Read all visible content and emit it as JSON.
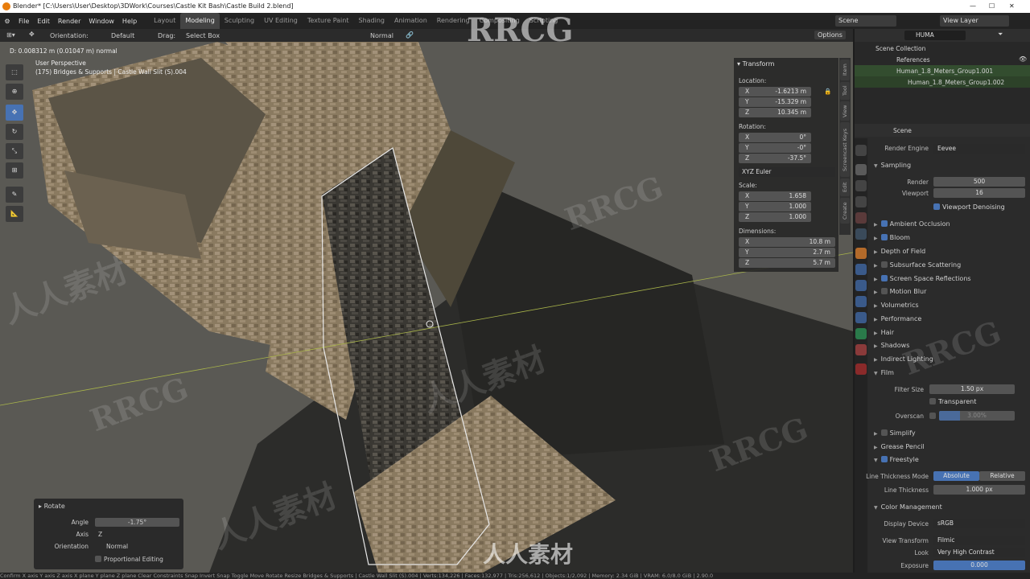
{
  "window_title": "Blender* [C:\\Users\\User\\Desktop\\3DWork\\Courses\\Castle Kit Bash\\Castle Build 2.blend]",
  "menu": [
    "File",
    "Edit",
    "Render",
    "Window",
    "Help"
  ],
  "workspaces": [
    "Layout",
    "Modeling",
    "Sculpting",
    "UV Editing",
    "Texture Paint",
    "Shading",
    "Animation",
    "Rendering",
    "Compositing",
    "Scripting"
  ],
  "active_workspace": "Modeling",
  "scene_name": "Scene",
  "view_layer": "View Layer",
  "toolbar": {
    "orientation_label": "Orientation:",
    "orientation_value": "Default",
    "drag_label": "Drag:",
    "drag_value": "Select Box",
    "pivot": "Normal",
    "options": "Options"
  },
  "viewport": {
    "info_line1": "D: 0.008312 m (0.01047 m) normal",
    "info_line2": "User Perspective",
    "info_line3": "(175) Bridges & Supports | Castle Wall Slit (S).004"
  },
  "transform": {
    "title": "Transform",
    "location_label": "Location:",
    "location": {
      "x": "-1.6213 m",
      "y": "-15.329 m",
      "z": "10.345 m"
    },
    "rotation_label": "Rotation:",
    "rotation": {
      "x": "0°",
      "y": "-0°",
      "z": "-37.5°"
    },
    "rotation_mode": "XYZ Euler",
    "scale_label": "Scale:",
    "scale": {
      "x": "1.658",
      "y": "1.000",
      "z": "1.000"
    },
    "dimensions_label": "Dimensions:",
    "dimensions": {
      "x": "10.8 m",
      "y": "2.7 m",
      "z": "5.7 m"
    }
  },
  "side_tabs": [
    "Item",
    "Tool",
    "View",
    "Screencast Keys",
    "Edit",
    "Create"
  ],
  "rotate_panel": {
    "title": "Rotate",
    "angle_label": "Angle",
    "angle": "-1.75°",
    "axis_label": "Axis",
    "axis": "Z",
    "orientation_label": "Orientation",
    "orientation": "Normal",
    "proportional": "Proportional Editing"
  },
  "outliner": {
    "search": "HUMA",
    "items": [
      "Scene Collection",
      "References",
      "Human_1.8_Meters_Group1.001",
      "Human_1.8_Meters_Group1.002"
    ]
  },
  "properties": {
    "scene": "Scene",
    "render_engine_label": "Render Engine",
    "render_engine": "Eevee",
    "sampling": "Sampling",
    "render_label": "Render",
    "render_val": "500",
    "viewport_label": "Viewport",
    "viewport_val": "16",
    "viewport_denoising": "Viewport Denoising",
    "sections": [
      "Ambient Occlusion",
      "Bloom",
      "Depth of Field",
      "Subsurface Scattering",
      "Screen Space Reflections",
      "Motion Blur",
      "Volumetrics",
      "Performance",
      "Hair",
      "Shadows",
      "Indirect Lighting",
      "Film"
    ],
    "checked": [
      "Ambient Occlusion",
      "Bloom",
      "Screen Space Reflections"
    ],
    "checkbox_sections": [
      "Ambient Occlusion",
      "Bloom",
      "Subsurface Scattering",
      "Screen Space Reflections",
      "Motion Blur"
    ],
    "filter_size_label": "Filter Size",
    "filter_size": "1.50 px",
    "transparent": "Transparent",
    "overscan_label": "Overscan",
    "overscan": "3.00%",
    "simplify": "Simplify",
    "grease_pencil": "Grease Pencil",
    "freestyle": "Freestyle",
    "line_thickness_mode_label": "Line Thickness Mode",
    "absolute": "Absolute",
    "relative": "Relative",
    "line_thickness_label": "Line Thickness",
    "line_thickness": "1.000 px",
    "color_management": "Color Management",
    "display_device_label": "Display Device",
    "display_device": "sRGB",
    "view_transform_label": "View Transform",
    "view_transform": "Filmic",
    "look_label": "Look",
    "look": "Very High Contrast",
    "exposure_label": "Exposure",
    "exposure": "0.000"
  },
  "status": "Confirm  X axis  Y axis  Z axis  X plane  Y plane  Z plane  Clear Constraints  Snap Invert  Snap Toggle  Move  Rotate  Resize          Bridges & Supports | Castle Wall Slit (S).004 | Verts:134,226 | Faces:132,977 | Tris:256,612 | Objects:1/2,092 | Memory: 2.34 GiB | VRAM: 6.0/8.0 GiB | 2.90.0",
  "watermarks": [
    "RRCG",
    "人人素材"
  ]
}
